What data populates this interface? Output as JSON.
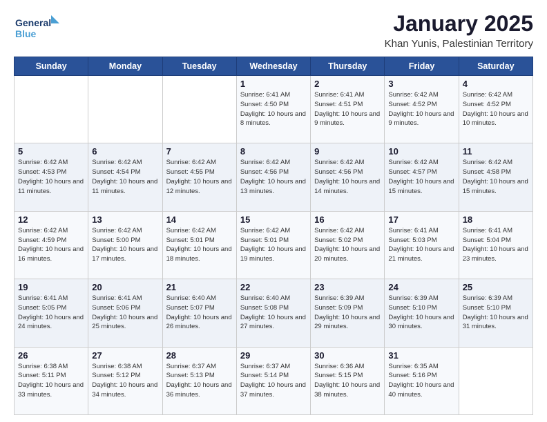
{
  "header": {
    "logo_line1": "General",
    "logo_line2": "Blue",
    "title": "January 2025",
    "subtitle": "Khan Yunis, Palestinian Territory"
  },
  "weekdays": [
    "Sunday",
    "Monday",
    "Tuesday",
    "Wednesday",
    "Thursday",
    "Friday",
    "Saturday"
  ],
  "weeks": [
    [
      {
        "day": "",
        "sunrise": "",
        "sunset": "",
        "daylight": ""
      },
      {
        "day": "",
        "sunrise": "",
        "sunset": "",
        "daylight": ""
      },
      {
        "day": "",
        "sunrise": "",
        "sunset": "",
        "daylight": ""
      },
      {
        "day": "1",
        "sunrise": "Sunrise: 6:41 AM",
        "sunset": "Sunset: 4:50 PM",
        "daylight": "Daylight: 10 hours and 8 minutes."
      },
      {
        "day": "2",
        "sunrise": "Sunrise: 6:41 AM",
        "sunset": "Sunset: 4:51 PM",
        "daylight": "Daylight: 10 hours and 9 minutes."
      },
      {
        "day": "3",
        "sunrise": "Sunrise: 6:42 AM",
        "sunset": "Sunset: 4:52 PM",
        "daylight": "Daylight: 10 hours and 9 minutes."
      },
      {
        "day": "4",
        "sunrise": "Sunrise: 6:42 AM",
        "sunset": "Sunset: 4:52 PM",
        "daylight": "Daylight: 10 hours and 10 minutes."
      }
    ],
    [
      {
        "day": "5",
        "sunrise": "Sunrise: 6:42 AM",
        "sunset": "Sunset: 4:53 PM",
        "daylight": "Daylight: 10 hours and 11 minutes."
      },
      {
        "day": "6",
        "sunrise": "Sunrise: 6:42 AM",
        "sunset": "Sunset: 4:54 PM",
        "daylight": "Daylight: 10 hours and 11 minutes."
      },
      {
        "day": "7",
        "sunrise": "Sunrise: 6:42 AM",
        "sunset": "Sunset: 4:55 PM",
        "daylight": "Daylight: 10 hours and 12 minutes."
      },
      {
        "day": "8",
        "sunrise": "Sunrise: 6:42 AM",
        "sunset": "Sunset: 4:56 PM",
        "daylight": "Daylight: 10 hours and 13 minutes."
      },
      {
        "day": "9",
        "sunrise": "Sunrise: 6:42 AM",
        "sunset": "Sunset: 4:56 PM",
        "daylight": "Daylight: 10 hours and 14 minutes."
      },
      {
        "day": "10",
        "sunrise": "Sunrise: 6:42 AM",
        "sunset": "Sunset: 4:57 PM",
        "daylight": "Daylight: 10 hours and 15 minutes."
      },
      {
        "day": "11",
        "sunrise": "Sunrise: 6:42 AM",
        "sunset": "Sunset: 4:58 PM",
        "daylight": "Daylight: 10 hours and 15 minutes."
      }
    ],
    [
      {
        "day": "12",
        "sunrise": "Sunrise: 6:42 AM",
        "sunset": "Sunset: 4:59 PM",
        "daylight": "Daylight: 10 hours and 16 minutes."
      },
      {
        "day": "13",
        "sunrise": "Sunrise: 6:42 AM",
        "sunset": "Sunset: 5:00 PM",
        "daylight": "Daylight: 10 hours and 17 minutes."
      },
      {
        "day": "14",
        "sunrise": "Sunrise: 6:42 AM",
        "sunset": "Sunset: 5:01 PM",
        "daylight": "Daylight: 10 hours and 18 minutes."
      },
      {
        "day": "15",
        "sunrise": "Sunrise: 6:42 AM",
        "sunset": "Sunset: 5:01 PM",
        "daylight": "Daylight: 10 hours and 19 minutes."
      },
      {
        "day": "16",
        "sunrise": "Sunrise: 6:42 AM",
        "sunset": "Sunset: 5:02 PM",
        "daylight": "Daylight: 10 hours and 20 minutes."
      },
      {
        "day": "17",
        "sunrise": "Sunrise: 6:41 AM",
        "sunset": "Sunset: 5:03 PM",
        "daylight": "Daylight: 10 hours and 21 minutes."
      },
      {
        "day": "18",
        "sunrise": "Sunrise: 6:41 AM",
        "sunset": "Sunset: 5:04 PM",
        "daylight": "Daylight: 10 hours and 23 minutes."
      }
    ],
    [
      {
        "day": "19",
        "sunrise": "Sunrise: 6:41 AM",
        "sunset": "Sunset: 5:05 PM",
        "daylight": "Daylight: 10 hours and 24 minutes."
      },
      {
        "day": "20",
        "sunrise": "Sunrise: 6:41 AM",
        "sunset": "Sunset: 5:06 PM",
        "daylight": "Daylight: 10 hours and 25 minutes."
      },
      {
        "day": "21",
        "sunrise": "Sunrise: 6:40 AM",
        "sunset": "Sunset: 5:07 PM",
        "daylight": "Daylight: 10 hours and 26 minutes."
      },
      {
        "day": "22",
        "sunrise": "Sunrise: 6:40 AM",
        "sunset": "Sunset: 5:08 PM",
        "daylight": "Daylight: 10 hours and 27 minutes."
      },
      {
        "day": "23",
        "sunrise": "Sunrise: 6:39 AM",
        "sunset": "Sunset: 5:09 PM",
        "daylight": "Daylight: 10 hours and 29 minutes."
      },
      {
        "day": "24",
        "sunrise": "Sunrise: 6:39 AM",
        "sunset": "Sunset: 5:10 PM",
        "daylight": "Daylight: 10 hours and 30 minutes."
      },
      {
        "day": "25",
        "sunrise": "Sunrise: 6:39 AM",
        "sunset": "Sunset: 5:10 PM",
        "daylight": "Daylight: 10 hours and 31 minutes."
      }
    ],
    [
      {
        "day": "26",
        "sunrise": "Sunrise: 6:38 AM",
        "sunset": "Sunset: 5:11 PM",
        "daylight": "Daylight: 10 hours and 33 minutes."
      },
      {
        "day": "27",
        "sunrise": "Sunrise: 6:38 AM",
        "sunset": "Sunset: 5:12 PM",
        "daylight": "Daylight: 10 hours and 34 minutes."
      },
      {
        "day": "28",
        "sunrise": "Sunrise: 6:37 AM",
        "sunset": "Sunset: 5:13 PM",
        "daylight": "Daylight: 10 hours and 36 minutes."
      },
      {
        "day": "29",
        "sunrise": "Sunrise: 6:37 AM",
        "sunset": "Sunset: 5:14 PM",
        "daylight": "Daylight: 10 hours and 37 minutes."
      },
      {
        "day": "30",
        "sunrise": "Sunrise: 6:36 AM",
        "sunset": "Sunset: 5:15 PM",
        "daylight": "Daylight: 10 hours and 38 minutes."
      },
      {
        "day": "31",
        "sunrise": "Sunrise: 6:35 AM",
        "sunset": "Sunset: 5:16 PM",
        "daylight": "Daylight: 10 hours and 40 minutes."
      },
      {
        "day": "",
        "sunrise": "",
        "sunset": "",
        "daylight": ""
      }
    ]
  ]
}
